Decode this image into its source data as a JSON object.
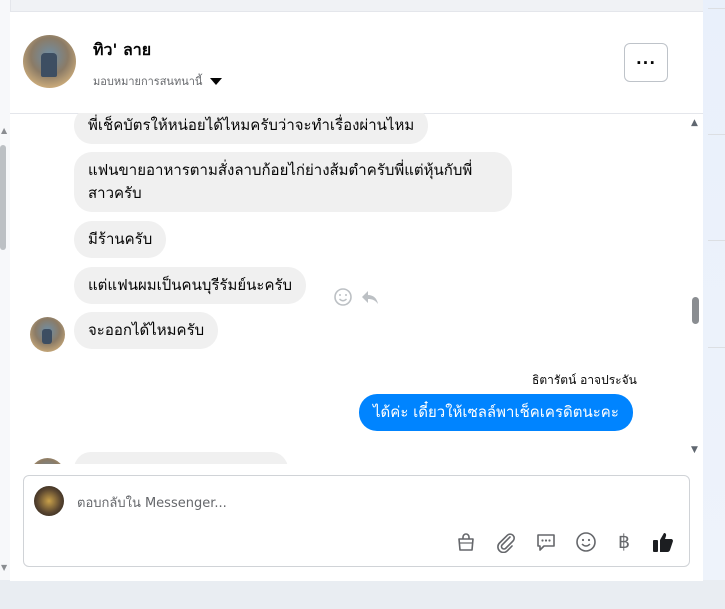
{
  "header": {
    "contact_name": "ทิว' ลาย",
    "assign_label": "มอบหมายการสนทนานี้",
    "more_label": "···"
  },
  "messages": [
    {
      "from": "them",
      "text": "พี่เช็คบัตรให้หน่อยได้ไหมครับว่าจะทำเรื่องผ่านไหม"
    },
    {
      "from": "them",
      "text": "แฟนขายอาหารตามสั่งลาบก้อยไก่ย่างส้มตำครับพี่แต่หุ้นกับพี่สาวครับ"
    },
    {
      "from": "them",
      "text": "มีร้านครับ"
    },
    {
      "from": "them",
      "text": "แต่แฟนผมเป็นคนบุรีรัมย์นะครับ"
    },
    {
      "from": "them",
      "text": "จะออกได้ไหมครับ"
    },
    {
      "from": "me",
      "sender": "ธิตารัตน์ อาจประจัน",
      "text": "ได้ค่ะ เดี๋ยวให้เซลล์พาเช็คเครดิตนะคะ"
    }
  ],
  "composer": {
    "placeholder": "ตอบกลับใน Messenger..."
  },
  "toolbar_icons": [
    "shopping-bag-icon",
    "paperclip-icon",
    "saved-replies-icon",
    "emoji-icon",
    "baht-icon",
    "thumbs-up-icon"
  ],
  "baht_symbol": "฿",
  "colors": {
    "accent": "#0084ff",
    "bubble_received": "#f0f0f0",
    "text": "#050505",
    "muted": "#65676b"
  }
}
